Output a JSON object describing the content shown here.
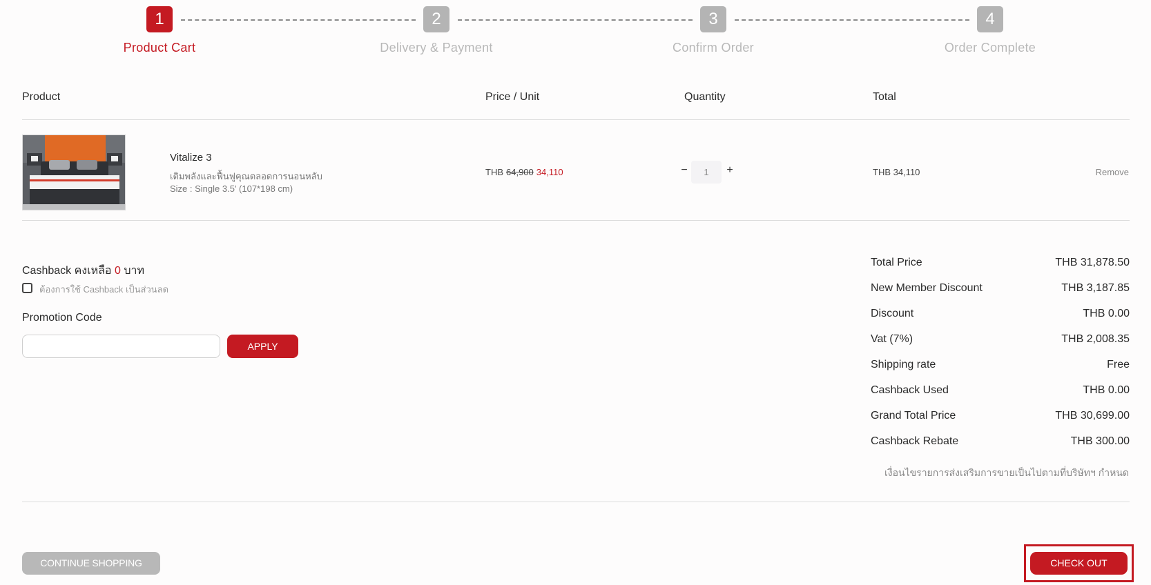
{
  "stepper": {
    "steps": [
      {
        "number": "1",
        "label": "Product Cart",
        "state": "active"
      },
      {
        "number": "2",
        "label": "Delivery & Payment",
        "state": "inactive"
      },
      {
        "number": "3",
        "label": "Confirm Order",
        "state": "inactive"
      },
      {
        "number": "4",
        "label": "Order Complete",
        "state": "inactive"
      }
    ]
  },
  "table": {
    "headers": {
      "product": "Product",
      "price": "Price / Unit",
      "quantity": "Quantity",
      "total": "Total"
    }
  },
  "item": {
    "name": "Vitalize 3",
    "description": "เติมพลังและฟื้นฟูคุณตลอดการนอนหลับ",
    "size": "Size : Single 3.5' (107*198 cm)",
    "currency": "THB",
    "original_price": "64,900",
    "sale_price": "34,110",
    "quantity": "1",
    "qty_minus": "−",
    "qty_plus": "+",
    "total": "THB 34,110",
    "remove_label": "Remove"
  },
  "cashback": {
    "prefix": "Cashback คงเหลือ",
    "amount": "0",
    "suffix": "บาท",
    "use_label": "ต้องการใช้ Cashback เป็นส่วนลด",
    "checked": false
  },
  "promotion": {
    "title": "Promotion Code",
    "value": "",
    "apply_label": "APPLY"
  },
  "summary": {
    "rows": [
      {
        "label": "Total Price",
        "value": "THB 31,878.50"
      },
      {
        "label": "New Member Discount",
        "value": "THB 3,187.85"
      },
      {
        "label": "Discount",
        "value": "THB 0.00"
      },
      {
        "label": "Vat (7%)",
        "value": "THB 2,008.35"
      },
      {
        "label": "Shipping rate",
        "value": "Free"
      },
      {
        "label": "Cashback Used",
        "value": "THB 0.00"
      },
      {
        "label": "Grand Total Price",
        "value": "THB 30,699.00"
      },
      {
        "label": "Cashback Rebate",
        "value": "THB 300.00"
      }
    ],
    "note": "เงื่อนไขรายการส่งเสริมการขายเป็นไปตามที่บริษัทฯ กำหนด"
  },
  "footer": {
    "continue_label": "CONTINUE SHOPPING",
    "checkout_label": "CHECK OUT"
  },
  "colors": {
    "accent": "#c41a22",
    "inactive": "#b4b4b4"
  }
}
